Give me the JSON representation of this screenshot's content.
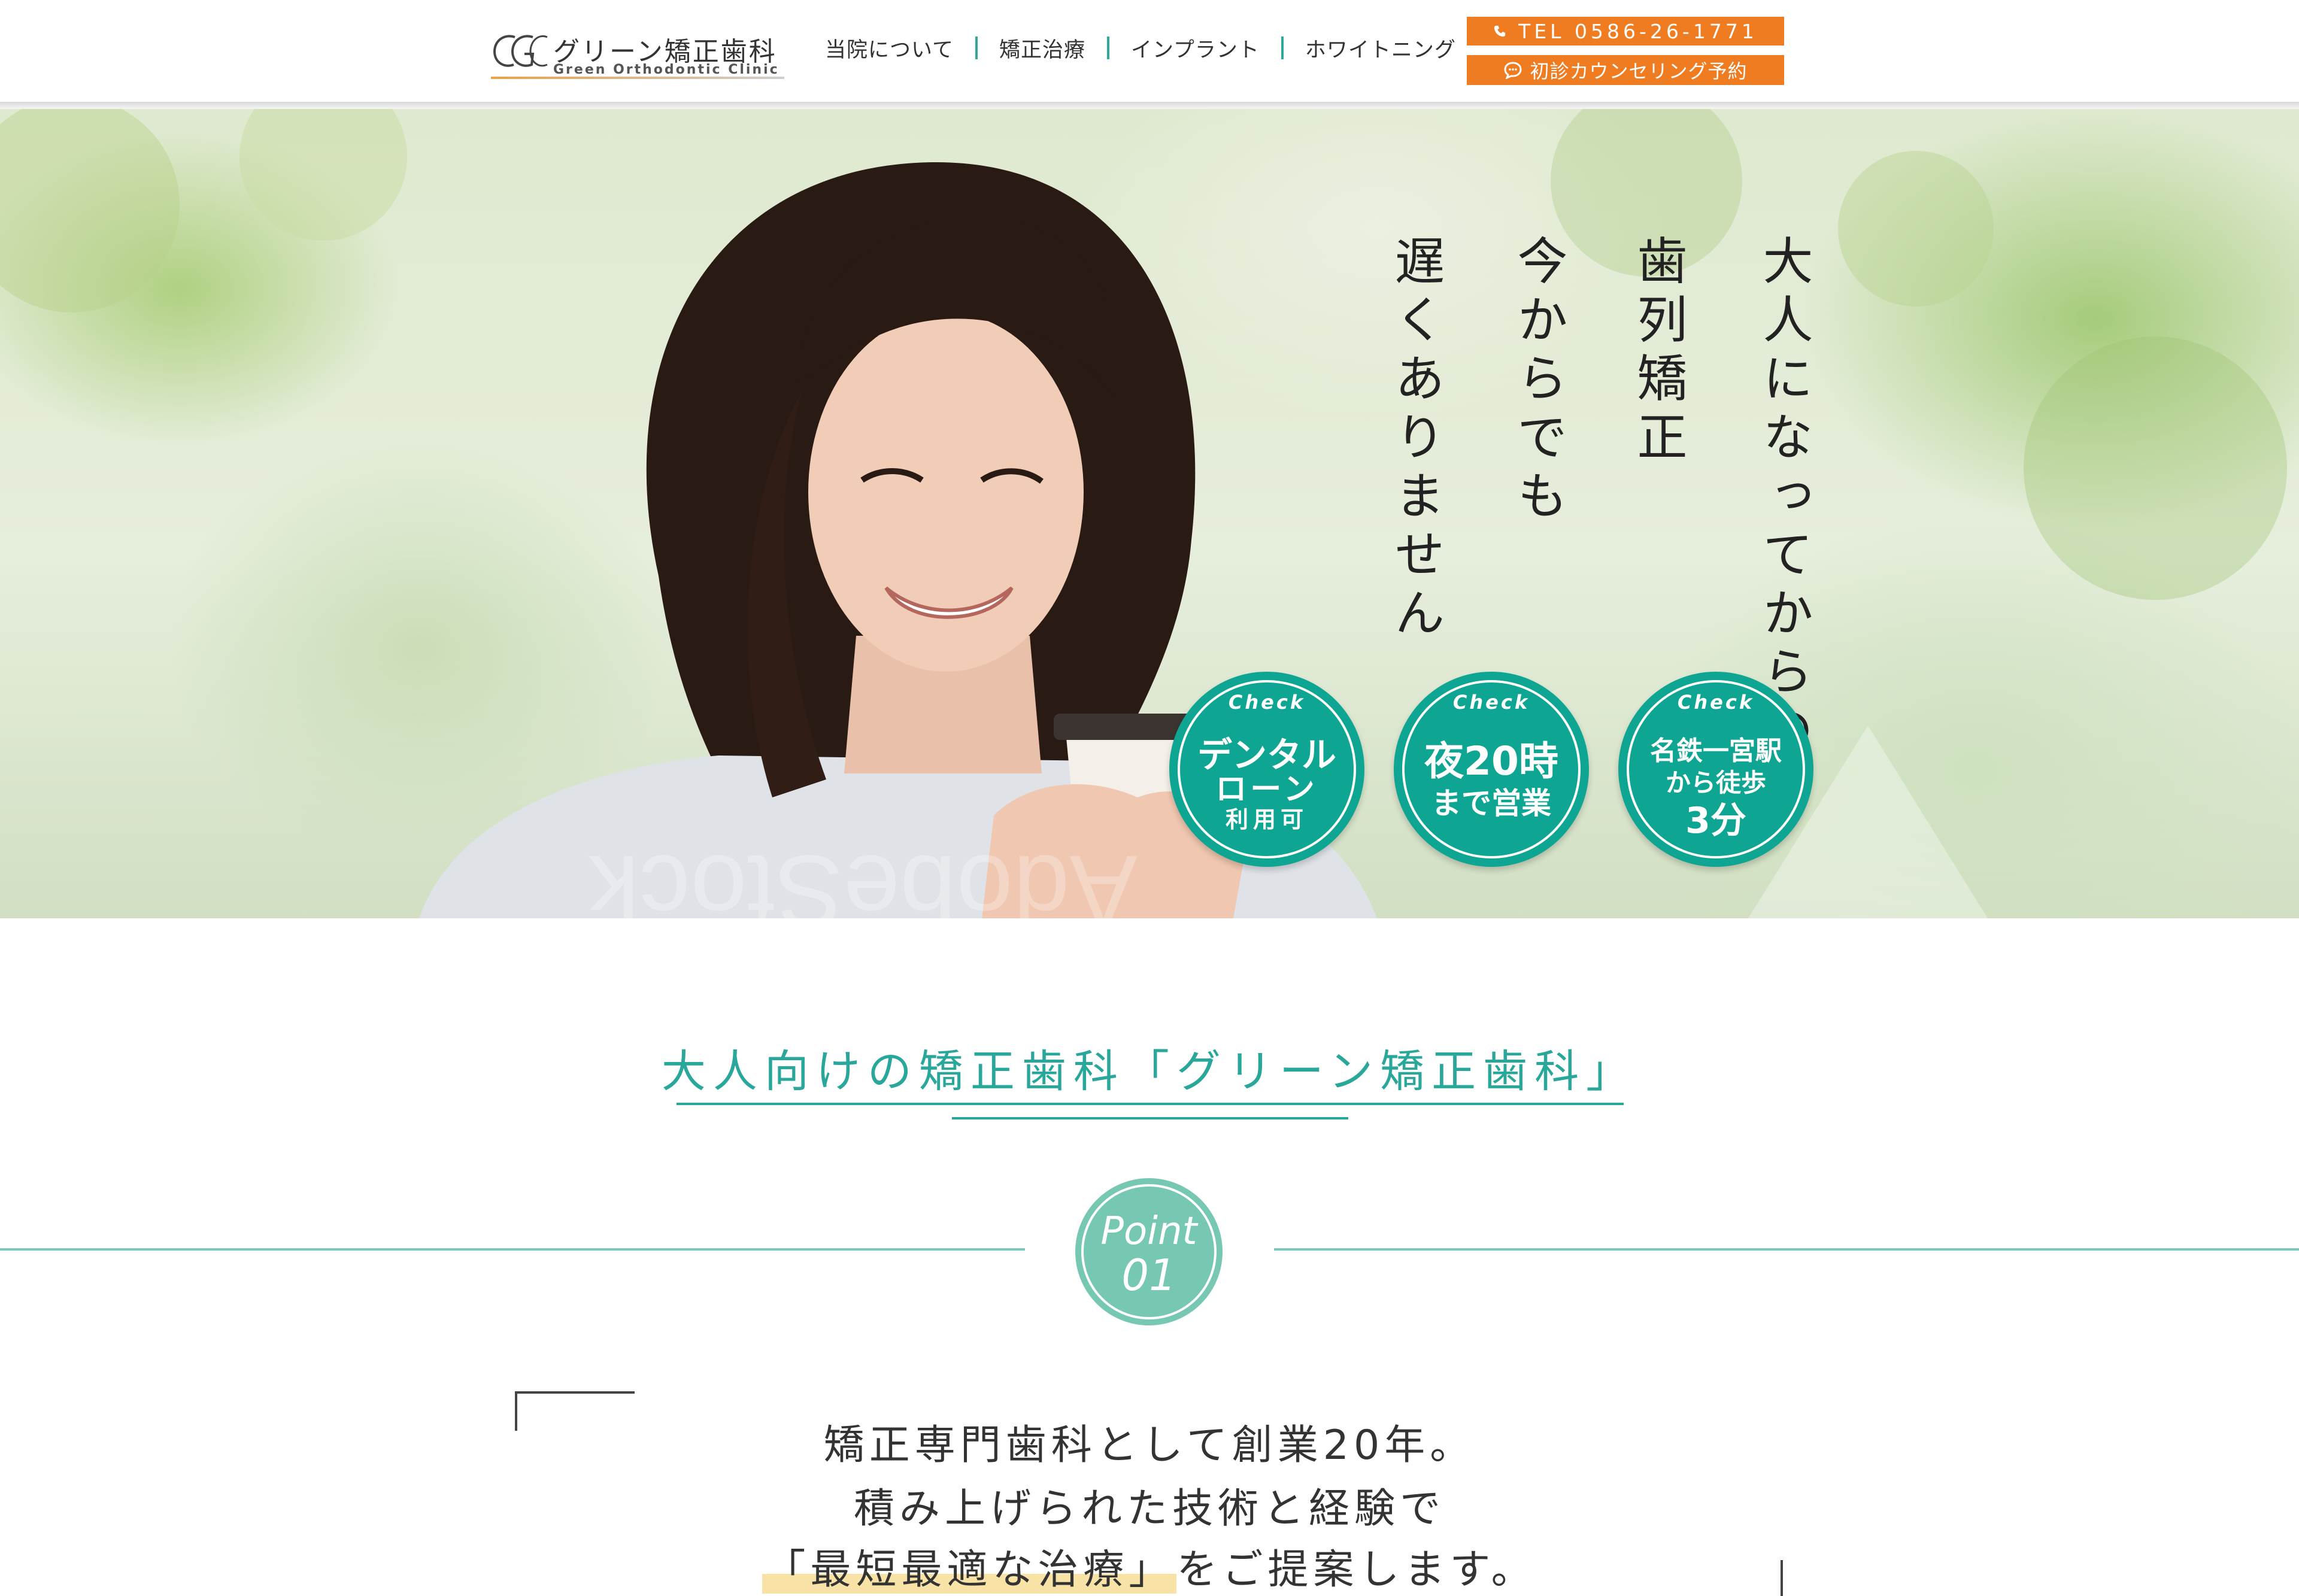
{
  "header": {
    "logo": {
      "mark": "GG",
      "name_ja": "グリーン矯正歯科",
      "name_en": "Green Orthodontic Clinic"
    },
    "nav": [
      {
        "label": "当院について"
      },
      {
        "label": "矯正治療"
      },
      {
        "label": "インプラント"
      },
      {
        "label": "ホワイトニング"
      }
    ],
    "tel_button": {
      "label": "TEL 0586-26-1771",
      "icon": "phone-icon"
    },
    "reserve_button": {
      "label": "初診カウンセリング予約",
      "icon": "chat-bubble-icon"
    }
  },
  "hero": {
    "copy": [
      "大人になってからの",
      "歯列矯正",
      "今からでも",
      "遅くありません"
    ],
    "watermark": "AdobeStock",
    "badges": [
      {
        "check": "Check",
        "lines": [
          "デンタル",
          "ローン",
          "利用可"
        ]
      },
      {
        "check": "Check",
        "lines": [
          "夜20時",
          "まで営業"
        ]
      },
      {
        "check": "Check",
        "lines": [
          "名鉄一宮駅",
          "から徒歩",
          "3分"
        ]
      }
    ]
  },
  "intro": {
    "title": "大人向けの矯正歯科「グリーン矯正歯科」",
    "point": {
      "word": "Point",
      "number": "01"
    },
    "lead": [
      "矯正専門歯科として創業20年。",
      "積み上げられた技術と経験で",
      "「最短最適な治療」",
      "をご提案します。"
    ]
  },
  "colors": {
    "accent_teal": "#29a79b",
    "badge_teal": "#0fa593",
    "point_green": "#76c8b2",
    "cta_orange": "#f07c22"
  }
}
